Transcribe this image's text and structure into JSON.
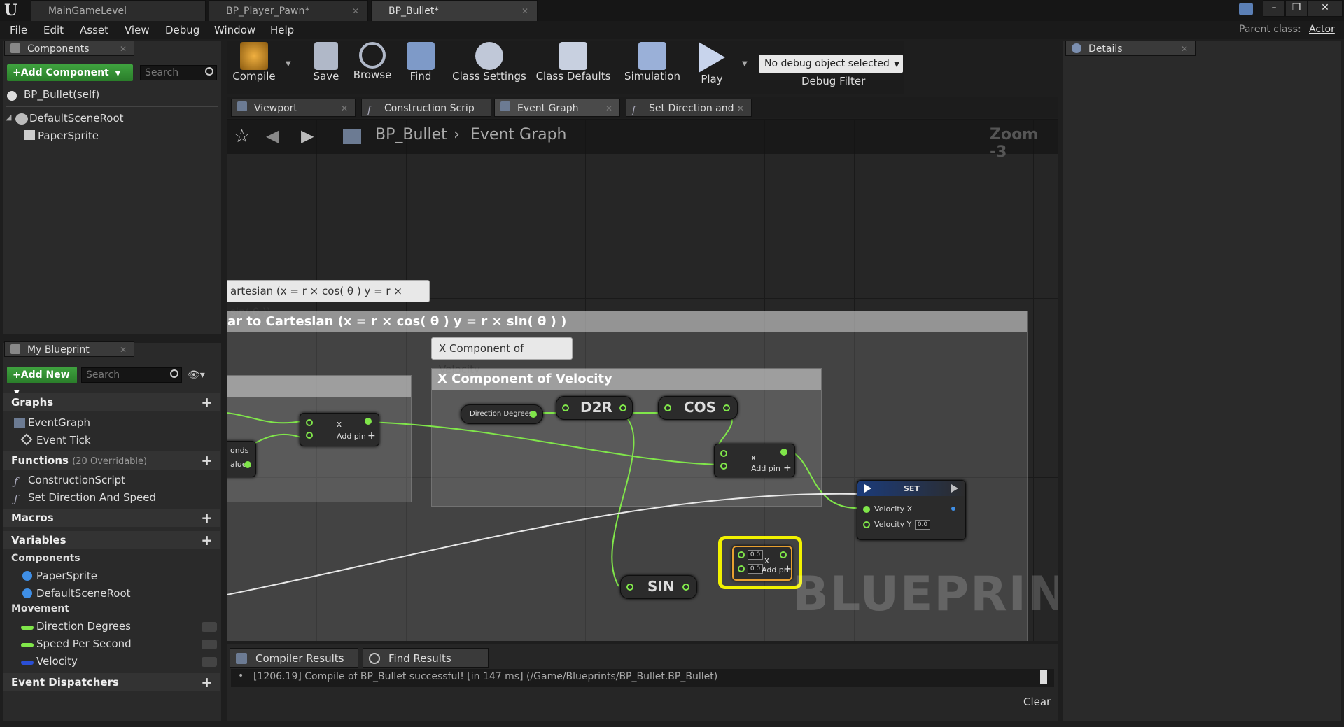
{
  "title_tabs": [
    {
      "label": "MainGameLevel",
      "active": false
    },
    {
      "label": "BP_Player_Pawn*",
      "active": false
    },
    {
      "label": "BP_Bullet*",
      "active": true
    }
  ],
  "menu": [
    "File",
    "Edit",
    "Asset",
    "View",
    "Debug",
    "Window",
    "Help"
  ],
  "parent_class": {
    "label": "Parent class:",
    "value": "Actor"
  },
  "components_panel": {
    "tab": "Components",
    "add_button": "+Add Component",
    "search_placeholder": "Search",
    "self_item": "BP_Bullet(self)",
    "tree": [
      "DefaultSceneRoot",
      "PaperSprite"
    ]
  },
  "my_blueprint": {
    "tab": "My Blueprint",
    "add_button": "+Add New",
    "search_placeholder": "Search",
    "graphs_header": "Graphs",
    "graphs": [
      "EventGraph",
      "Event Tick"
    ],
    "functions_header": "Functions",
    "functions_sub": "(20 Overridable)",
    "functions": [
      "ConstructionScript",
      "Set Direction And Speed"
    ],
    "macros_header": "Macros",
    "variables_header": "Variables",
    "var_groups": [
      {
        "name": "Components",
        "items": [
          "PaperSprite",
          "DefaultSceneRoot"
        ]
      },
      {
        "name": "Movement",
        "items": [
          "Direction Degrees",
          "Speed Per Second",
          "Velocity"
        ]
      }
    ],
    "dispatchers_header": "Event Dispatchers"
  },
  "toolbar": {
    "buttons": [
      "Compile",
      "Save",
      "Browse",
      "Find",
      "Class Settings",
      "Class Defaults",
      "Simulation",
      "Play"
    ],
    "debug_select": "No debug object selected",
    "debug_filter": "Debug Filter"
  },
  "graph_tabs": [
    "Viewport",
    "Construction Scrip",
    "Event Graph",
    "Set Direction and :"
  ],
  "breadcrumb": {
    "root": "BP_Bullet",
    "current": "Event Graph",
    "zoom": "Zoom -3"
  },
  "graph": {
    "bubble_outer": "artesian (x = r × cos( θ ) y = r × sin( θ ))",
    "comment_outer": "ar to Cartesian (x = r × cos( θ ) y = r × sin( θ ) )",
    "bubble_inner": "X Component of Velocity",
    "comment_inner": "X Component of Velocity",
    "direction_node": "Direction Degrees",
    "d2r": "D2R",
    "cos": "COS",
    "sin": "SIN",
    "multiply_mark": "x",
    "add_pin": "Add pin",
    "add_pin_plus": "+",
    "partial_onds": "onds",
    "partial_alue": "alue",
    "set_title": "SET",
    "velocity_x": "Velocity X",
    "velocity_y": "Velocity Y",
    "velocity_y_value": "0.0",
    "sel_input_a": "0.0",
    "sel_input_b": "0.0",
    "watermark": "BLUEPRINT"
  },
  "bottom_tabs": [
    "Compiler Results",
    "Find Results"
  ],
  "log_line": "[1206.19] Compile of BP_Bullet successful! [in 147 ms] (/Game/Blueprints/BP_Bullet.BP_Bullet)",
  "clear_label": "Clear",
  "details_tab": "Details",
  "colors": {
    "accent_green": "#80e64a",
    "selection": "#f2f200",
    "set_header": "#1b3b7a"
  }
}
